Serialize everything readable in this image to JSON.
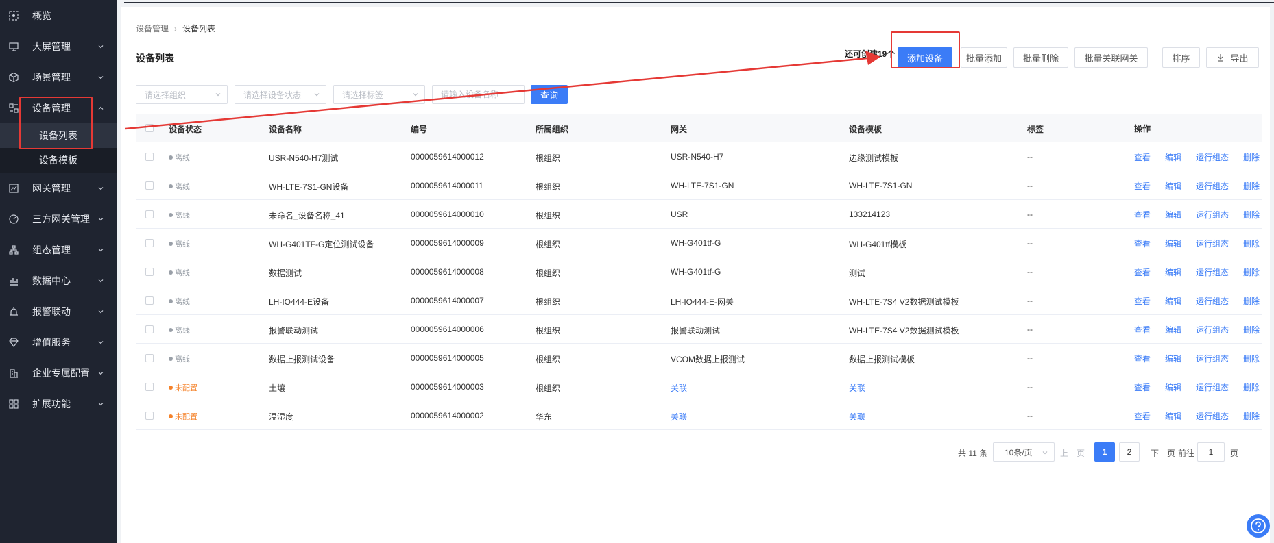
{
  "sidebar": {
    "items": [
      {
        "label": "概览",
        "icon": "overview-icon",
        "has_children": false
      },
      {
        "label": "大屏管理",
        "icon": "monitor-icon",
        "has_children": true
      },
      {
        "label": "场景管理",
        "icon": "cube-icon",
        "has_children": true
      },
      {
        "label": "设备管理",
        "icon": "device-grid-icon",
        "has_children": true,
        "expanded": true
      },
      {
        "label": "网关管理",
        "icon": "chart-box-icon",
        "has_children": true
      },
      {
        "label": "三方网关管理",
        "icon": "gauge-icon",
        "has_children": true
      },
      {
        "label": "组态管理",
        "icon": "org-chart-icon",
        "has_children": true
      },
      {
        "label": "数据中心",
        "icon": "bar-chart-icon",
        "has_children": true
      },
      {
        "label": "报警联动",
        "icon": "alarm-icon",
        "has_children": true
      },
      {
        "label": "增值服务",
        "icon": "diamond-icon",
        "has_children": true
      },
      {
        "label": "企业专属配置",
        "icon": "building-icon",
        "has_children": true
      },
      {
        "label": "扩展功能",
        "icon": "apps-icon",
        "has_children": true
      }
    ],
    "device_sub": [
      {
        "label": "设备列表",
        "active": true
      },
      {
        "label": "设备模板",
        "active": false
      }
    ]
  },
  "breadcrumb": {
    "parent": "设备管理",
    "current": "设备列表"
  },
  "page_title": "设备列表",
  "toolbar": {
    "quota_text": "还可创建19个",
    "add_device": "添加设备",
    "batch_add": "批量添加",
    "batch_delete": "批量删除",
    "batch_link_gateway": "批量关联网关",
    "sort": "排序",
    "export": "导出"
  },
  "filters": {
    "org_placeholder": "请选择组织",
    "status_placeholder": "请选择设备状态",
    "tag_placeholder": "请选择标签",
    "name_placeholder": "请输入设备名称",
    "query": "查询"
  },
  "table": {
    "columns": [
      "设备状态",
      "设备名称",
      "编号",
      "所属组织",
      "网关",
      "设备模板",
      "标签",
      "操作"
    ],
    "ops": [
      "查看",
      "编辑",
      "运行组态",
      "删除"
    ],
    "rows": [
      {
        "status": "离线",
        "status_type": "offline",
        "name": "USR-N540-H7测试",
        "id": "0000059614000012",
        "org": "根组织",
        "gateway": "USR-N540-H7",
        "gateway_link": false,
        "template": "边缘测试模板",
        "template_link": false,
        "tag": "--"
      },
      {
        "status": "离线",
        "status_type": "offline",
        "name": "WH-LTE-7S1-GN设备",
        "id": "0000059614000011",
        "org": "根组织",
        "gateway": "WH-LTE-7S1-GN",
        "gateway_link": false,
        "template": "WH-LTE-7S1-GN",
        "template_link": false,
        "tag": "--"
      },
      {
        "status": "离线",
        "status_type": "offline",
        "name": "未命名_设备名称_41",
        "id": "0000059614000010",
        "org": "根组织",
        "gateway": "USR",
        "gateway_link": false,
        "template": "133214123",
        "template_link": false,
        "tag": "--"
      },
      {
        "status": "离线",
        "status_type": "offline",
        "name": "WH-G401TF-G定位测试设备",
        "id": "0000059614000009",
        "org": "根组织",
        "gateway": "WH-G401tf-G",
        "gateway_link": false,
        "template": "WH-G401tf模板",
        "template_link": false,
        "tag": "--"
      },
      {
        "status": "离线",
        "status_type": "offline",
        "name": "数据测试",
        "id": "0000059614000008",
        "org": "根组织",
        "gateway": "WH-G401tf-G",
        "gateway_link": false,
        "template": "测试",
        "template_link": false,
        "tag": "--"
      },
      {
        "status": "离线",
        "status_type": "offline",
        "name": "LH-IO444-E设备",
        "id": "0000059614000007",
        "org": "根组织",
        "gateway": "LH-IO444-E-网关",
        "gateway_link": false,
        "template": "WH-LTE-7S4 V2数据测试模板",
        "template_link": false,
        "tag": "--"
      },
      {
        "status": "离线",
        "status_type": "offline",
        "name": "报警联动测试",
        "id": "0000059614000006",
        "org": "根组织",
        "gateway": "报警联动测试",
        "gateway_link": false,
        "template": "WH-LTE-7S4 V2数据测试模板",
        "template_link": false,
        "tag": "--"
      },
      {
        "status": "离线",
        "status_type": "offline",
        "name": "数据上报测试设备",
        "id": "0000059614000005",
        "org": "根组织",
        "gateway": "VCOM数据上报测试",
        "gateway_link": false,
        "template": "数据上报测试模板",
        "template_link": false,
        "tag": "--"
      },
      {
        "status": "未配置",
        "status_type": "unconfigured",
        "name": "土壤",
        "id": "0000059614000003",
        "org": "根组织",
        "gateway": "关联",
        "gateway_link": true,
        "template": "关联",
        "template_link": true,
        "tag": "--"
      },
      {
        "status": "未配置",
        "status_type": "unconfigured",
        "name": "温湿度",
        "id": "0000059614000002",
        "org": "华东",
        "gateway": "关联",
        "gateway_link": true,
        "template": "关联",
        "template_link": true,
        "tag": "--"
      }
    ]
  },
  "pagination": {
    "total_text": "共 11 条",
    "page_size": "10条/页",
    "prev": "上一页",
    "pages": [
      "1",
      "2"
    ],
    "current_page": "1",
    "next": "下一页",
    "goto_label": "前往",
    "goto_value": "1",
    "goto_suffix": "页"
  },
  "colors": {
    "primary": "#3b7cf7",
    "sidebar_bg": "#1f2430",
    "highlight": "#e53935",
    "offline": "#9aa0a8",
    "unconfigured": "#f5822a"
  }
}
